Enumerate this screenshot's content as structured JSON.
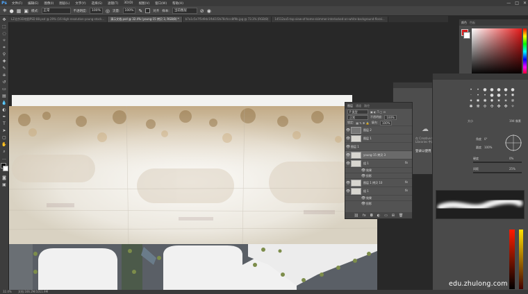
{
  "app": {
    "logo": "Ps"
  },
  "menu": [
    "文件(F)",
    "编辑(E)",
    "图像(I)",
    "图层(L)",
    "文字(Y)",
    "选择(S)",
    "滤镜(T)",
    "3D(D)",
    "视图(V)",
    "窗口(W)",
    "帮助(H)"
  ],
  "window_controls": [
    "—",
    "□",
    "✕"
  ],
  "options": {
    "mode_label": "模式:",
    "mode_value": "正常",
    "opacity_label": "不透明度:",
    "opacity_value": "100%",
    "flow_label": "流量:",
    "flow_value": "100%",
    "align_label": "对齐",
    "sample_label": "样本:",
    "sample_value": "当前图层"
  },
  "tabs": [
    {
      "label": "LZ北京3D地图PSD 88.psd @ 29% (16 High-resolution-young-stock...",
      "active": false
    },
    {
      "label": "演示文档.psd @ 32.4% (young-15 拷贝 3, RGB/8) *",
      "active": true
    },
    {
      "label": "b7a1c5e7f5d9dc1fb61f2b78cfccc8f9b.jpg @ 73.3% (RGB/8)",
      "active": false
    },
    {
      "label": "14512aa5-top-view-of-home-skimmer-interlocked-on-white-background-floral...",
      "active": false
    }
  ],
  "layers_panel": {
    "tabs": [
      "图层",
      "通道",
      "路径"
    ],
    "kind_label": "P 类型",
    "blend": "正常",
    "opacity_label": "不透明度:",
    "opacity": "100%",
    "lock_label": "锁定:",
    "fill_label": "填充:",
    "fill": "100%",
    "rows": [
      {
        "name": "图层 2",
        "fx": "",
        "sub": false,
        "selected": false,
        "thumb": "dark"
      },
      {
        "name": "图层 1",
        "fx": "",
        "sub": false,
        "selected": false,
        "thumb": "light"
      },
      {
        "name": "图层 1",
        "fx": "",
        "sub": false,
        "selected": false,
        "thumb": "none"
      },
      {
        "name": "young-15 拷贝 3",
        "fx": "",
        "sub": false,
        "selected": true,
        "thumb": "light"
      },
      {
        "name": "组 1",
        "fx": "fx",
        "sub": false,
        "selected": false,
        "thumb": "light"
      },
      {
        "name": "效果",
        "fx": "",
        "sub": true,
        "selected": false,
        "thumb": "none"
      },
      {
        "name": "投影",
        "fx": "",
        "sub": true,
        "selected": false,
        "thumb": "none"
      },
      {
        "name": "图层 1 拷贝 10",
        "fx": "fx",
        "sub": false,
        "selected": false,
        "thumb": "light"
      },
      {
        "name": "组 1",
        "fx": "fx",
        "sub": false,
        "selected": false,
        "thumb": "light"
      },
      {
        "name": "效果",
        "fx": "",
        "sub": true,
        "selected": false,
        "thumb": "none"
      },
      {
        "name": "投影",
        "fx": "",
        "sub": true,
        "selected": false,
        "thumb": "none"
      }
    ],
    "footer_icons": [
      "link",
      "fx",
      "mask",
      "adjust",
      "folder",
      "new",
      "trash"
    ]
  },
  "library_panel": {
    "text": "在 Creative Cloud Libraries 中访问资源",
    "action": "登录以使用"
  },
  "color_panel": {
    "tabs": [
      "颜色",
      "色板"
    ],
    "foreground": "#d71e1e",
    "background": "#ffffff"
  },
  "brush_panel": {
    "size_label": "大小",
    "size_value": "194 像素",
    "angle_label": "角度",
    "angle_value": "0°",
    "roundness_label": "圆度",
    "roundness_value": "100%",
    "hardness_label": "硬度",
    "hardness_value": "0%",
    "spacing_label": "间距",
    "spacing_value": "25%"
  },
  "status": {
    "zoom": "32.4%",
    "doc": "文档:166.2M/1011.9M"
  },
  "watermark": "edu.zhulong.com"
}
